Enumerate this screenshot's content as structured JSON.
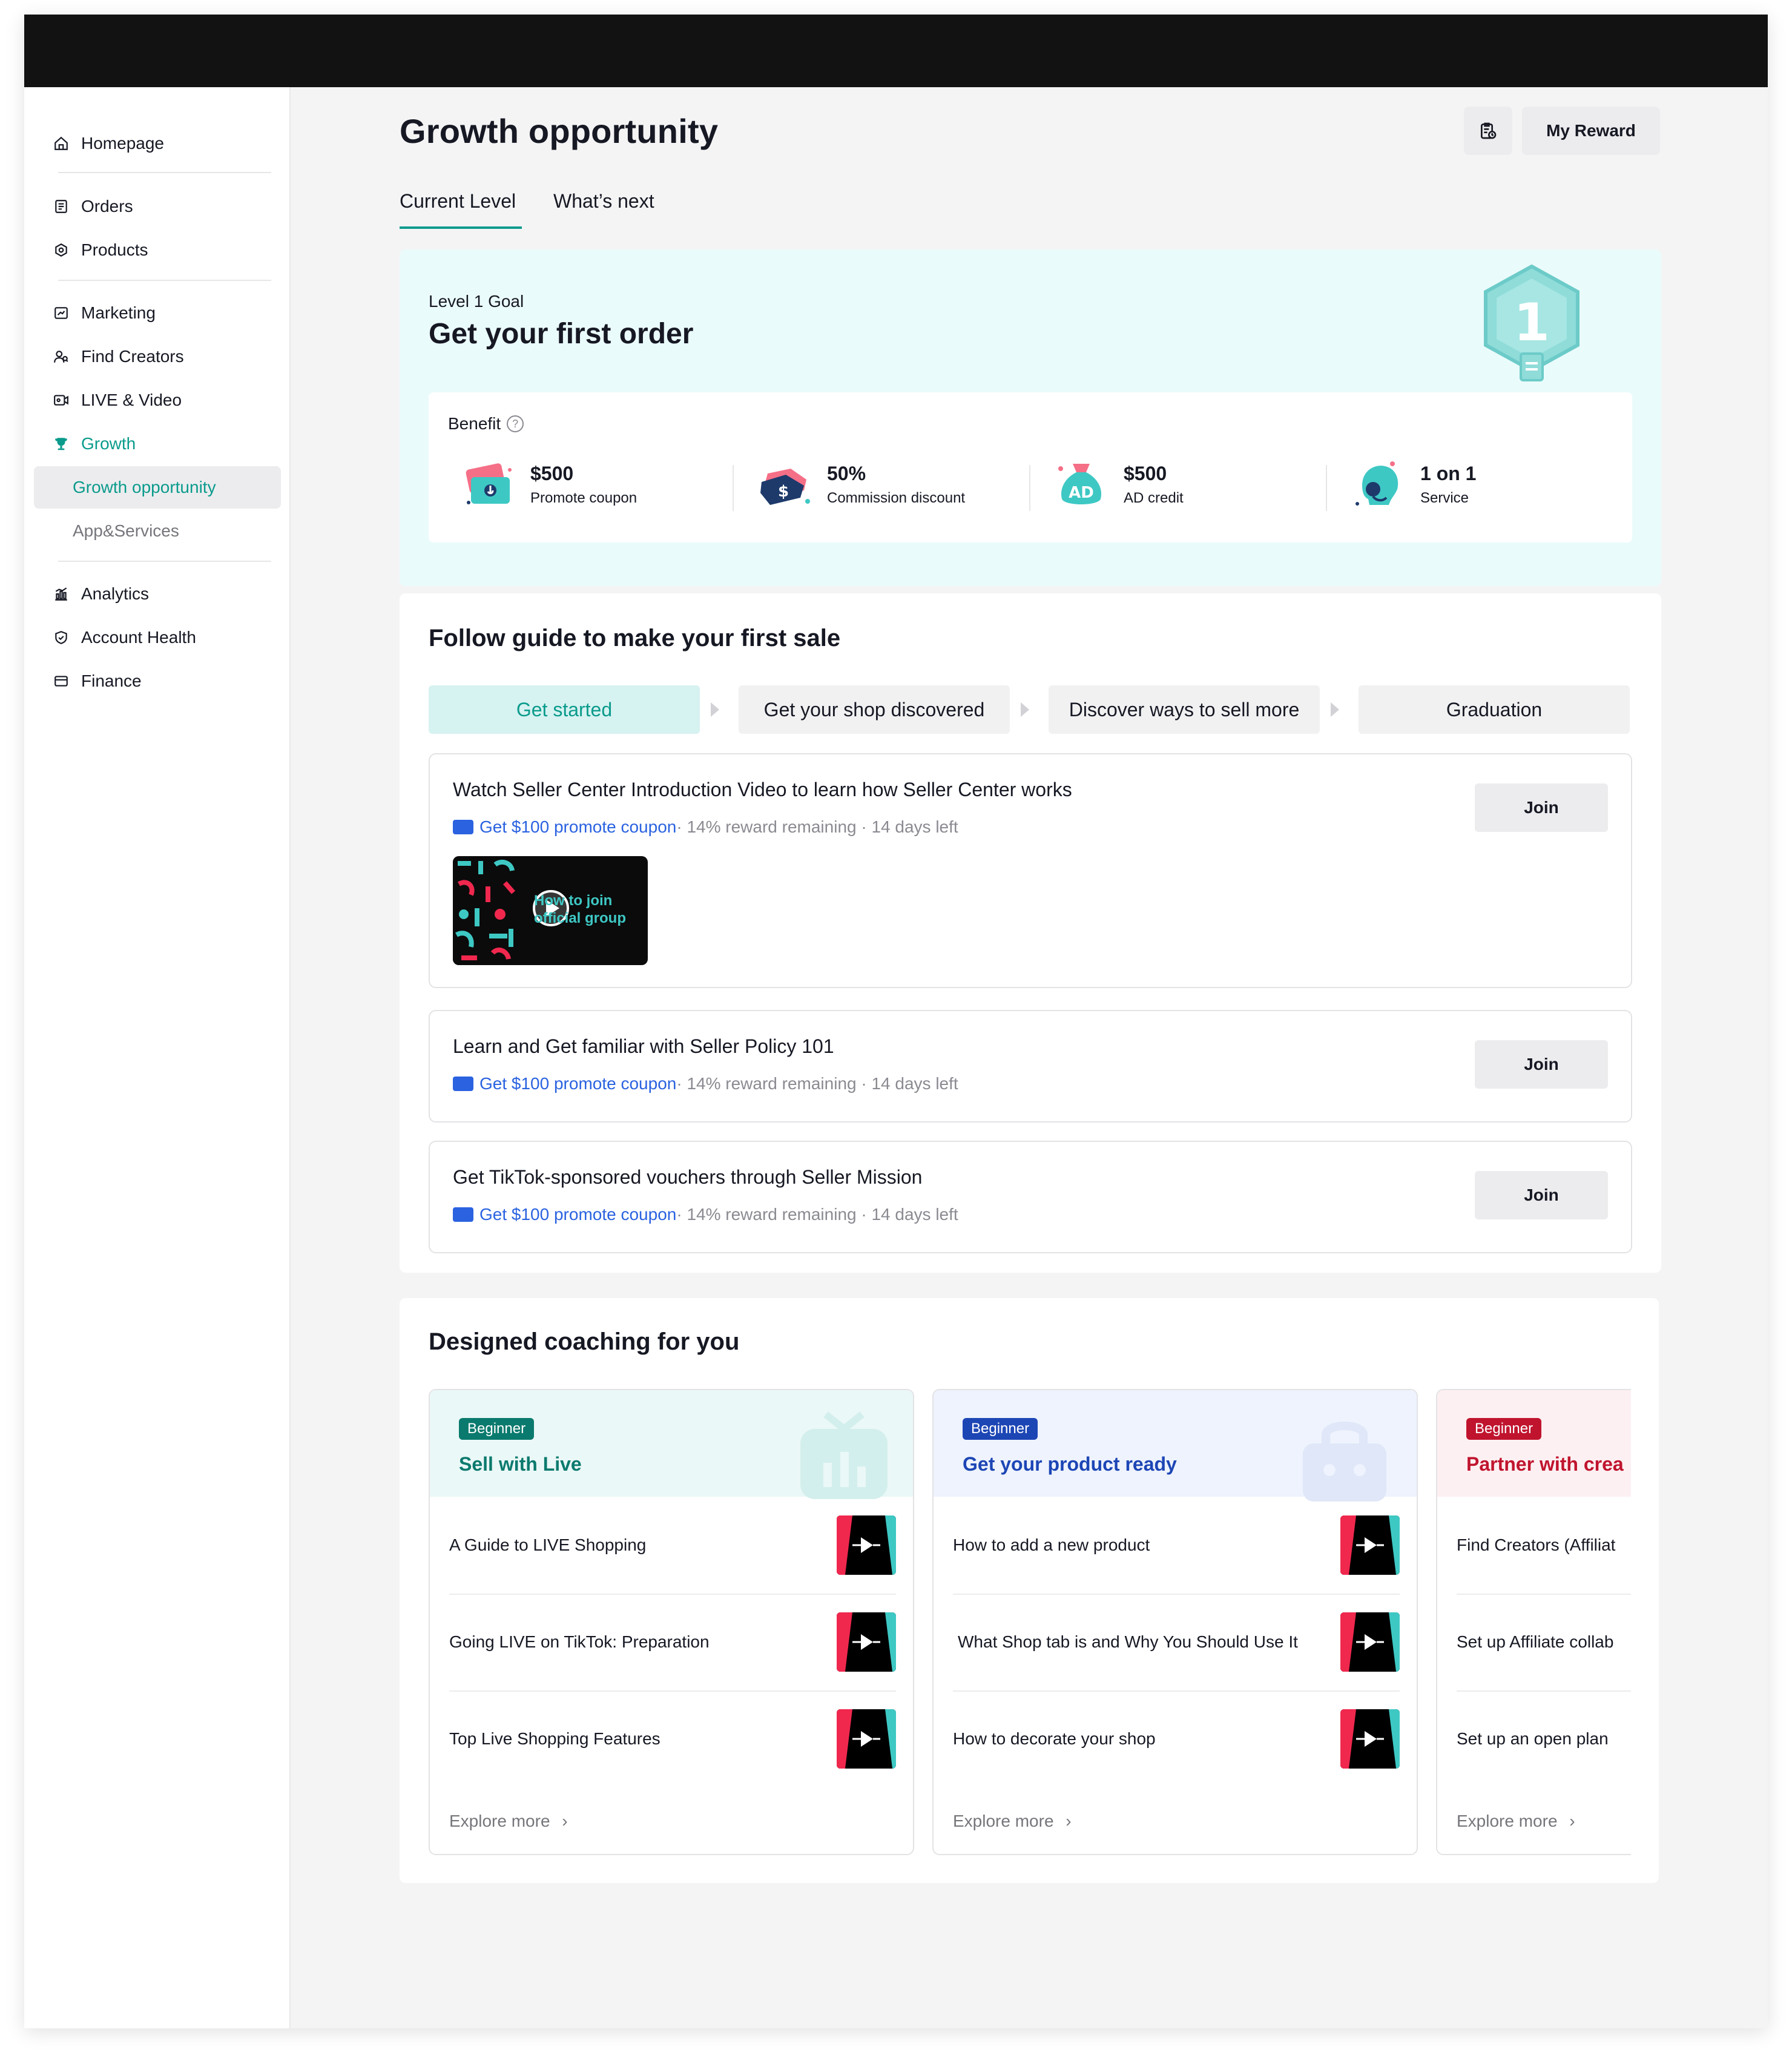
{
  "sidebar": {
    "items": [
      {
        "label": "Homepage",
        "icon": "home-icon"
      },
      {
        "label": "Orders",
        "icon": "orders-icon"
      },
      {
        "label": "Products",
        "icon": "products-icon"
      },
      {
        "label": "Marketing",
        "icon": "marketing-icon"
      },
      {
        "label": "Find Creators",
        "icon": "creators-icon"
      },
      {
        "label": "LIVE & Video",
        "icon": "video-icon"
      },
      {
        "label": "Growth",
        "icon": "trophy-icon"
      },
      {
        "label": "Growth opportunity"
      },
      {
        "label": "App&Services"
      },
      {
        "label": "Analytics",
        "icon": "analytics-icon"
      },
      {
        "label": "Account Health",
        "icon": "shield-icon"
      },
      {
        "label": "Finance",
        "icon": "wallet-icon"
      }
    ]
  },
  "header": {
    "title": "Growth opportunity",
    "reward_label": "My Reward",
    "tabs": [
      "Current Level",
      "What’s next"
    ]
  },
  "level": {
    "subtitle": "Level 1 Goal",
    "title": "Get your first order",
    "badge_number": "1",
    "benefit_label": "Benefit",
    "benefits": [
      {
        "value": "$500",
        "label": "Promote coupon"
      },
      {
        "value": "50%",
        "label": "Commission discount"
      },
      {
        "value": "$500",
        "label": "AD credit",
        "art_text": "AD"
      },
      {
        "value": "1 on 1",
        "label": "Service"
      }
    ]
  },
  "guide": {
    "title": "Follow guide to make your first sale",
    "steps": [
      "Get started",
      "Get your shop discovered",
      "Discover ways to sell more",
      "Graduation"
    ],
    "tasks": [
      {
        "title": "Watch Seller Center Introduction Video to learn how Seller Center works",
        "link": "Get $100 promote coupon",
        "meta": " · 14% reward remaining · 14 days left",
        "join": "Join",
        "video_text": "How to join official group"
      },
      {
        "title": "Learn and Get familiar with Seller Policy 101",
        "link": "Get $100 promote coupon",
        "meta": " · 14% reward remaining · 14 days left",
        "join": "Join"
      },
      {
        "title": "Get TikTok-sponsored vouchers through Seller Mission",
        "link": "Get $100 promote coupon",
        "meta": " · 14% reward remaining · 14 days left",
        "join": "Join"
      }
    ]
  },
  "coaching": {
    "title": "Designed coaching for you",
    "columns": [
      {
        "tag": "Beginner",
        "title": "Sell with Live",
        "items": [
          "A Guide to LIVE Shopping",
          "Going LIVE on TikTok: Preparation",
          "Top Live Shopping Features"
        ],
        "explore": "Explore more",
        "accent": "#0b7a6e",
        "bg": "#eaf8f7"
      },
      {
        "tag": "Beginner",
        "title": "Get your product ready",
        "items": [
          "How to add a new product",
          "What Shop tab is and Why You Should Use It",
          "How to decorate your shop"
        ],
        "explore": "Explore more",
        "accent": "#1d46b5",
        "bg": "#eef3fd"
      },
      {
        "tag": "Beginner",
        "title": "Partner with crea",
        "items": [
          "Find Creators (Affiliat",
          "Set up Affiliate collab",
          "Set up an open plan"
        ],
        "explore": "Explore more",
        "accent": "#c0142e",
        "bg": "#fdf0f2"
      }
    ]
  },
  "colors": {
    "brand": "#0a9b8c",
    "link": "#2a62e0"
  }
}
